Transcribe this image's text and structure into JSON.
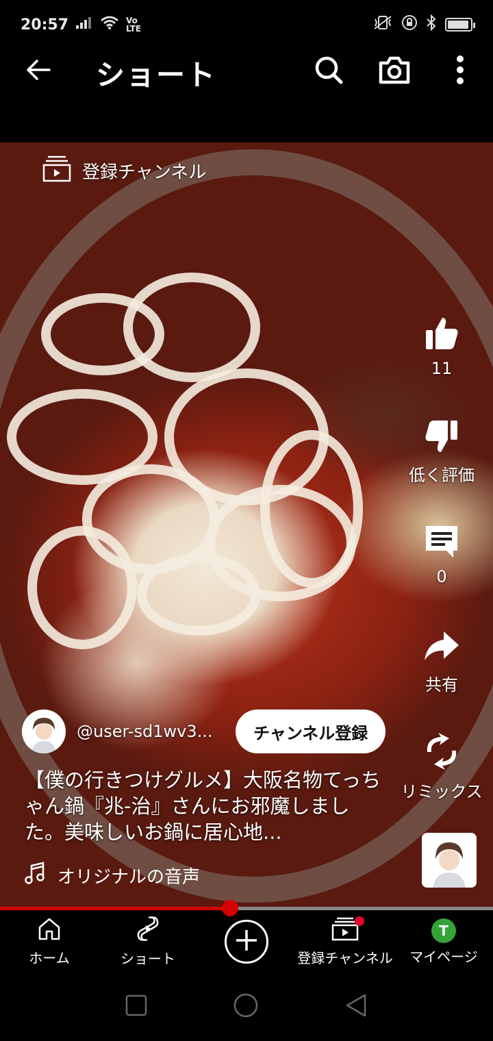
{
  "status_bar": {
    "time": "20:57",
    "network_label": "Vo LTE"
  },
  "app_bar": {
    "title": "ショート",
    "back_icon": "arrow-left-icon",
    "search_icon": "search-icon",
    "camera_icon": "camera-icon",
    "more_icon": "more-vert-icon"
  },
  "video": {
    "subscriptions_chip": "登録チャンネル"
  },
  "actions": {
    "like_count": "11",
    "dislike_label": "低く評価",
    "comment_count": "0",
    "share_label": "共有",
    "remix_label": "リミックス"
  },
  "channel": {
    "name": "@user-sd1wv3...",
    "subscribe_label": "チャンネル登録"
  },
  "caption": "【僕の行きつけグルメ】大阪名物てっちゃん鍋『兆-治』さんにお邪魔しました。美味しいお鍋に居心地...",
  "audio": {
    "label": "オリジナルの音声"
  },
  "progress": {
    "fraction": 0.467
  },
  "bottom_nav": {
    "home": "ホーム",
    "shorts": "ショート",
    "subscriptions": "登録チャンネル",
    "profile": "マイページ",
    "profile_initial": "T"
  },
  "colors": {
    "accent_red": "#d40000",
    "background": "#000000",
    "profile_green": "#35a338"
  }
}
